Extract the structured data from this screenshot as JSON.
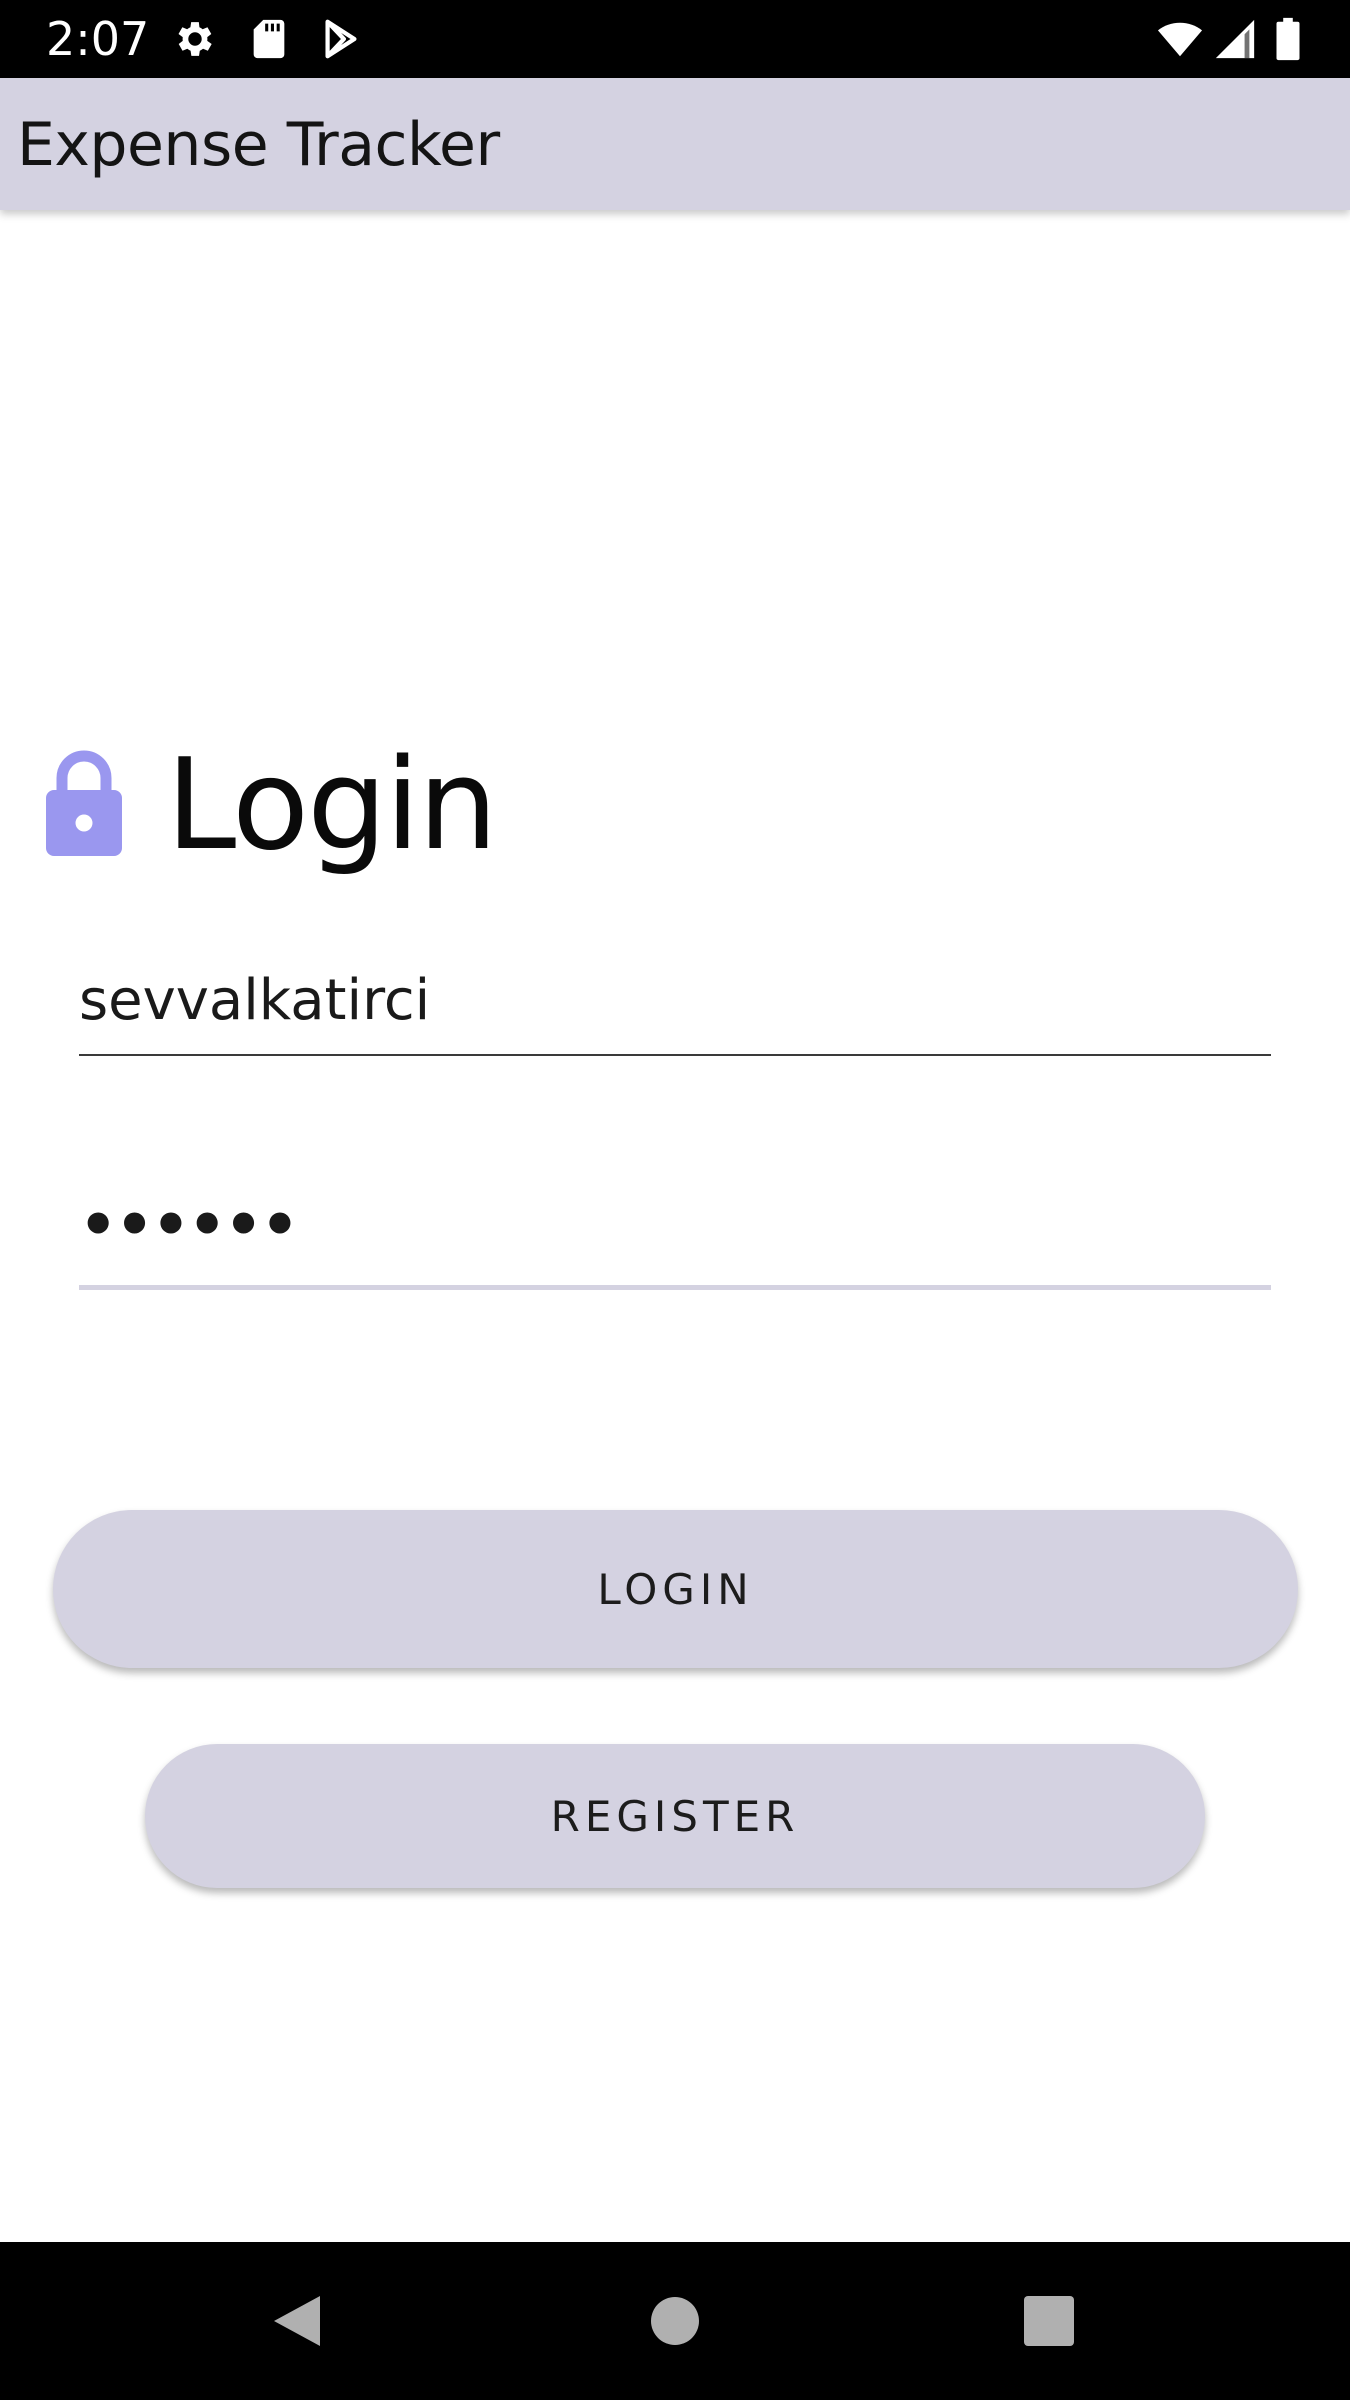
{
  "status_bar": {
    "time": "2:07",
    "icons": [
      "settings-icon",
      "sd-card-icon",
      "play-store-icon",
      "wifi-icon",
      "signal-icon",
      "battery-icon"
    ]
  },
  "app_bar": {
    "title": "Expense Tracker"
  },
  "login": {
    "heading": "Login",
    "heading_icon": "lock-icon",
    "accent_color": "#9a97ef",
    "username_value": "sevvalkatirci",
    "password_value": "••••••"
  },
  "buttons": {
    "login_label": "LOGIN",
    "register_label": "REGISTER",
    "color": "#d4d2e1"
  },
  "nav_bar": {
    "items": [
      "back-icon",
      "home-icon",
      "recents-icon"
    ]
  }
}
